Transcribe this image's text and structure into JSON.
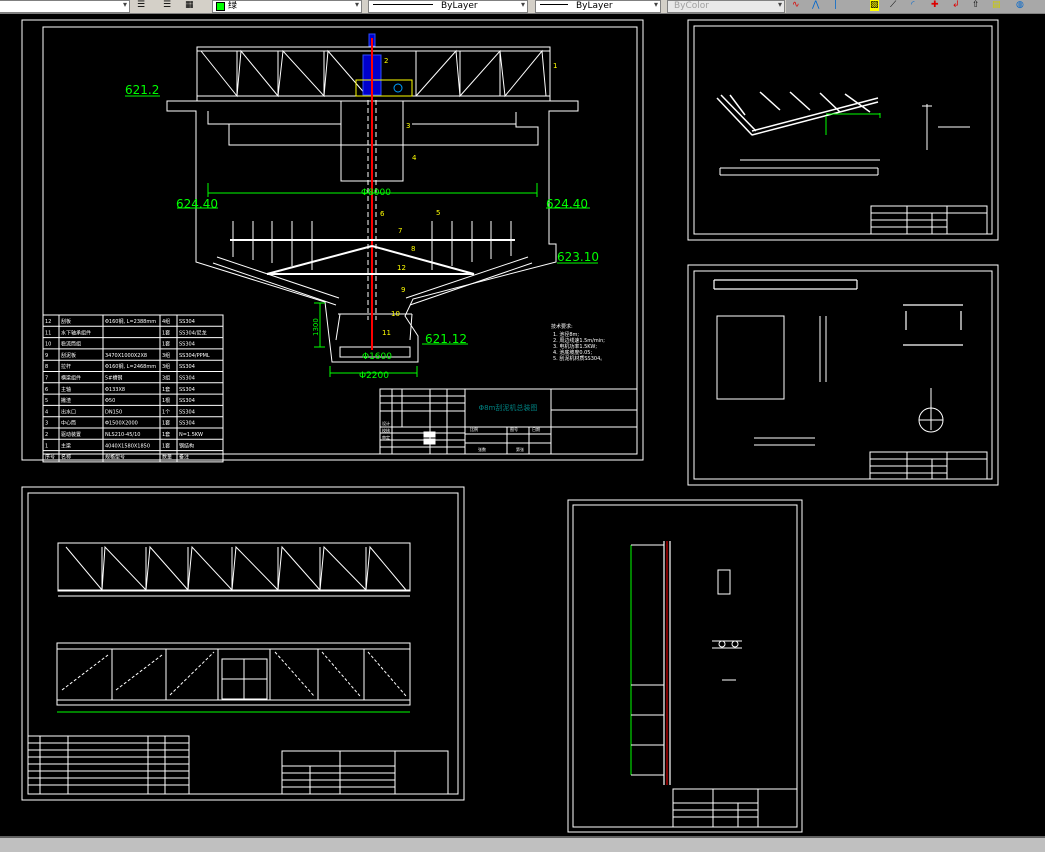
{
  "toolbar": {
    "layer_value": "绿",
    "layer_color": "#00ff00",
    "linetype_value": "ByLayer",
    "lineweight_value": "ByLayer",
    "plotstyle_value": "ByColor"
  },
  "colors": {
    "background": "#000000",
    "lines": "#ffffff",
    "dimension": "#00ff00",
    "leader": "#ffff00",
    "shaft": "#ff0000",
    "drive": "#0000ff",
    "title": "#008080"
  },
  "main_drawing": {
    "elevations": {
      "top": "621.2",
      "left_water": "624.40",
      "right_water": "624.40",
      "right_low": "623.10",
      "bottom": "621.12"
    },
    "dims": {
      "tank_dia": "Φ8000",
      "pit_dia": "Φ1600",
      "pit_outer": "Φ2200",
      "pit_depth": "1300"
    },
    "part_labels": [
      "1",
      "2",
      "3",
      "4",
      "5",
      "6",
      "7",
      "8",
      "9",
      "10",
      "11",
      "12"
    ],
    "notes_title": "技术要求:",
    "notes": [
      "1. 池径8m;",
      "2. 周边线速1.5m/min;",
      "3. 电机功率1.5KW;",
      "4. 池底坡度0.05;",
      "5. 刮泥机材质SS304。"
    ],
    "bom_header": [
      "序号",
      "名称",
      "规格型号",
      "数量",
      "备注"
    ],
    "bom_rows": [
      [
        "12",
        "刮板",
        "Φ160钢, L=2388mm",
        "4组",
        "SS304"
      ],
      [
        "11",
        "水下轴承组件",
        "",
        "1套",
        "SS304/尼龙"
      ],
      [
        "10",
        "稳流筒组",
        "",
        "1套",
        "SS304"
      ],
      [
        "9",
        "刮泥板",
        "3470X1000X2X8",
        "3组",
        "SS304/PPML"
      ],
      [
        "8",
        "拉杆",
        "Φ160钢, L=2468mm",
        "3组",
        "SS304"
      ],
      [
        "7",
        "横梁组件",
        "5#槽钢",
        "3组",
        "SS304"
      ],
      [
        "6",
        "主轴",
        "Φ133X8",
        "1套",
        "SS304"
      ],
      [
        "5",
        "撇渣",
        "Φ50",
        "1根",
        "SS304"
      ],
      [
        "4",
        "出水口",
        "DN150",
        "1个",
        "SS304"
      ],
      [
        "3",
        "中心筒",
        "Φ1500X2000",
        "1套",
        "SS304"
      ],
      [
        "2",
        "驱动装置",
        "NLS210-45/10",
        "1套",
        "N=1.5KW"
      ],
      [
        "1",
        "主梁",
        "4040X1580X1850",
        "1套",
        "钢结构"
      ]
    ],
    "title_block": {
      "title": "Φ8m刮泥机总装图",
      "c1": "设计",
      "c2": "校核",
      "c3": "审定",
      "c4": "比例",
      "c5": "图号",
      "c6": "日期",
      "c7": "张数",
      "c8": "第张"
    }
  }
}
